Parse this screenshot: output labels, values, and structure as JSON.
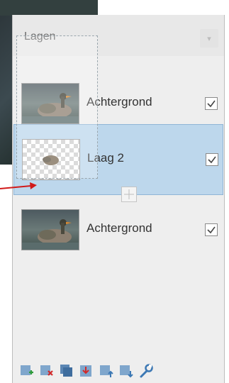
{
  "panel": {
    "title": "Lagen"
  },
  "layers": [
    {
      "name": "Achtergrond",
      "visible": true
    },
    {
      "name": "Laag 2",
      "visible": true,
      "selected": true
    },
    {
      "name": "Achtergrond",
      "visible": true
    }
  ],
  "toolbar": {
    "tools": [
      "add-layer-icon",
      "delete-layer-icon",
      "duplicate-layer-icon",
      "merge-layer-down-icon",
      "move-layer-up-icon",
      "move-layer-down-icon",
      "layer-properties-icon"
    ]
  },
  "colors": {
    "accent": "#3c78b4",
    "selection": "#b4d2eb",
    "annotation": "#d11a1a"
  }
}
